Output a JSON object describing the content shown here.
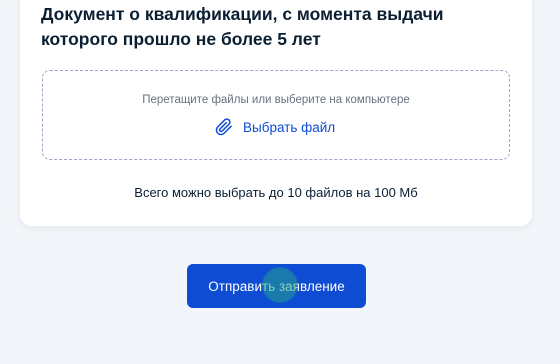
{
  "document_section": {
    "title": "Документ о квалификации, с момента выдачи которого прошло не более 5 лет",
    "dropzone": {
      "hint": "Перетащите файлы или выберите на компьютере",
      "choose_file_label": "Выбрать файл",
      "choose_file_icon": "paperclip-icon"
    },
    "limit_note": "Всего можно выбрать до 10 файлов на 100 Мб"
  },
  "actions": {
    "submit_label": "Отправить заявление"
  },
  "colors": {
    "primary": "#0d4cd3",
    "text": "#0b1f33",
    "muted_text": "#66727f",
    "background": "#f2f5f9",
    "dropzone_border": "#9aa8c4"
  }
}
